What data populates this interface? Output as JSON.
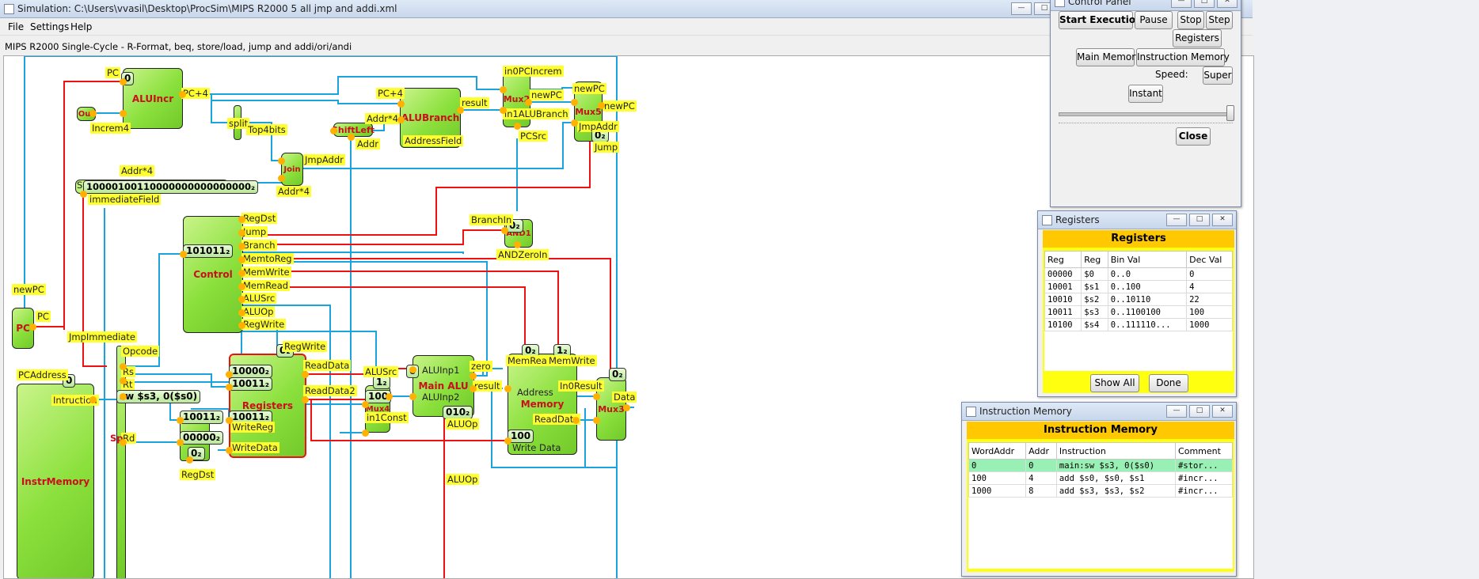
{
  "main_window": {
    "title": "Simulation: C:\\Users\\vvasil\\Desktop\\ProcSim\\MIPS R2000 5 all jmp and addi.xml"
  },
  "menu": {
    "file": "File",
    "settings": "Settings",
    "help": "Help"
  },
  "subtitle": "MIPS R2000 Single-Cycle - R-Format, beq, store/load, jump and addi/ori/andi",
  "components": {
    "alu_incr": "ALUIncr",
    "alu_branch": "ALUBranch",
    "shift_left": "ShiftLeft",
    "join": "Join",
    "control": "Control",
    "registers": "Registers",
    "main_alu": "Main ALU",
    "memory": "Memory",
    "mux2": "Mux2",
    "mux5": "Mux5",
    "mux4": "Mux4",
    "mux3": "Mux3",
    "and1": "AND1",
    "pc": "PC",
    "instr_memory": "InstrMemory",
    "out": "Out"
  },
  "labels": {
    "pc_top": "PC",
    "pc_plus4_a": "PC+4",
    "pc_plus4_b": "PC+4",
    "increm4": "Increm4",
    "top4bits": "Top4bits",
    "addr_x4_a": "Addr*4",
    "addr_x4_b": "Addr*4",
    "addr_x4_c": "Addr*4",
    "addr": "Addr",
    "address_field": "AddressField",
    "result_a": "result",
    "new_pc_a": "newPC",
    "new_pc_b": "newPC",
    "new_pc_c": "newPC",
    "new_pc_left": "newPC",
    "in0_pc_increm": "in0PCIncrem",
    "in1_alu_branch": "in1ALUBranch",
    "jmp_addr_a": "JmpAddr",
    "jmp_addr_b": "JmpAddr",
    "jump_a": "Jump",
    "pc_src": "PCSrc",
    "immediate_field": "immediateField",
    "reg_dst": "RegDst",
    "jump_b": "Jump",
    "branch": "Branch",
    "mem_to_reg": "MemtoReg",
    "mem_write": "MemWrite",
    "mem_read": "MemRead",
    "alu_src": "ALUSrc",
    "alu_op": "ALUOp",
    "reg_write": "RegWrite",
    "branch_in": "BranchIn",
    "and_zero_in": "ANDZeroIn",
    "pc_side": "PC",
    "jmp_immediate": "JmpImmediate",
    "opcode": "Opcode",
    "rs": "Rs",
    "rt": "Rt",
    "rd": "Rd",
    "sp": "Sp",
    "pc_address": "PCAddress",
    "instruction": "Intruction",
    "reg_write_b": "RegWrite",
    "read_data": "ReadData",
    "read_data2": "ReadData2",
    "alu_src_b": "ALUSrc",
    "alu_inp1": "ALUInp1",
    "alu_inp2": "ALUInp2",
    "zero": "zero",
    "result_b": "result",
    "alu_op_b": "ALUOp",
    "alu_op_c": "ALUOp",
    "in1_const": "in1Const",
    "address": "Address",
    "read_data_mem": "ReadData",
    "write_data_mem": "Write Data",
    "mem_read_b": "MemRead",
    "mem_write_b": "MemWrite",
    "in0_result": "In0Result",
    "data": "Data",
    "write_reg": "WriteReg",
    "write_data": "WriteData",
    "reg_dst_b": "RegDst",
    "reg_r1": "1",
    "reg_r2": "2",
    "s_short": "S"
  },
  "values": {
    "pc_init": "0",
    "out": "Out",
    "split": "split",
    "immediate": "10000100110000000000000000₂",
    "control_op": "101011₂",
    "jump_sel": "0₂",
    "and1_in": "0₂",
    "regwrite_ctrl": "0₂",
    "pc_address": "0",
    "instr_text": "sw $s3, 0($s0)",
    "reg_read1": "10000₂",
    "reg_read2": "10011₂",
    "rt_field": "10011₂",
    "rd_field": "00000₂",
    "regdst_sel": "0₂",
    "write_reg_val": "10011₂",
    "mux4_sel": "1₂",
    "mux4_in": "100",
    "zero_out": "0",
    "aluop_val": "010₂",
    "memread_val": "0₂",
    "memwrite_val": "1₂",
    "mux3_sel": "0₂",
    "mem_write_data": "100"
  },
  "control_panel": {
    "title": "Control Panel",
    "start": "Start Execution",
    "pause": "Pause",
    "stop": "Stop",
    "step": "Step",
    "registers": "Registers",
    "main_memory": "Main Memory",
    "instruction_memory": "Instruction Memory",
    "speed_label": "Speed:",
    "speed_value": "Super",
    "instant": "Instant",
    "close": "Close",
    "speed_slider": 1.0
  },
  "registers_window": {
    "title": "Registers",
    "header": "Registers",
    "columns": [
      "Reg",
      "Reg",
      "Bin Val",
      "Dec Val"
    ],
    "rows": [
      [
        "00000",
        "$0",
        "0..0",
        "0"
      ],
      [
        "10001",
        "$s1",
        "0..100",
        "4"
      ],
      [
        "10010",
        "$s2",
        "0..10110",
        "22"
      ],
      [
        "10011",
        "$s3",
        "0..1100100",
        "100"
      ],
      [
        "10100",
        "$s4",
        "0..111110...",
        "1000"
      ]
    ],
    "show_all": "Show All",
    "done": "Done"
  },
  "instr_window": {
    "title": "Instruction Memory",
    "header": "Instruction Memory",
    "columns": [
      "WordAddr",
      "Addr",
      "Instruction",
      "Comment"
    ],
    "rows": [
      [
        "0",
        "0",
        "main:sw $s3, 0($s0)",
        "#stor..."
      ],
      [
        "100",
        "4",
        "add $s0, $s0, $s1",
        "#incr..."
      ],
      [
        "1000",
        "8",
        "add $s3, $s3, $s2",
        "#incr..."
      ]
    ]
  },
  "colors": {
    "wire_blue": "#1aa3dd",
    "wire_red": "#ee1111",
    "label_yellow": "#ffff30",
    "comp_green": "#8be03c",
    "highlight": "#99f0b4"
  }
}
